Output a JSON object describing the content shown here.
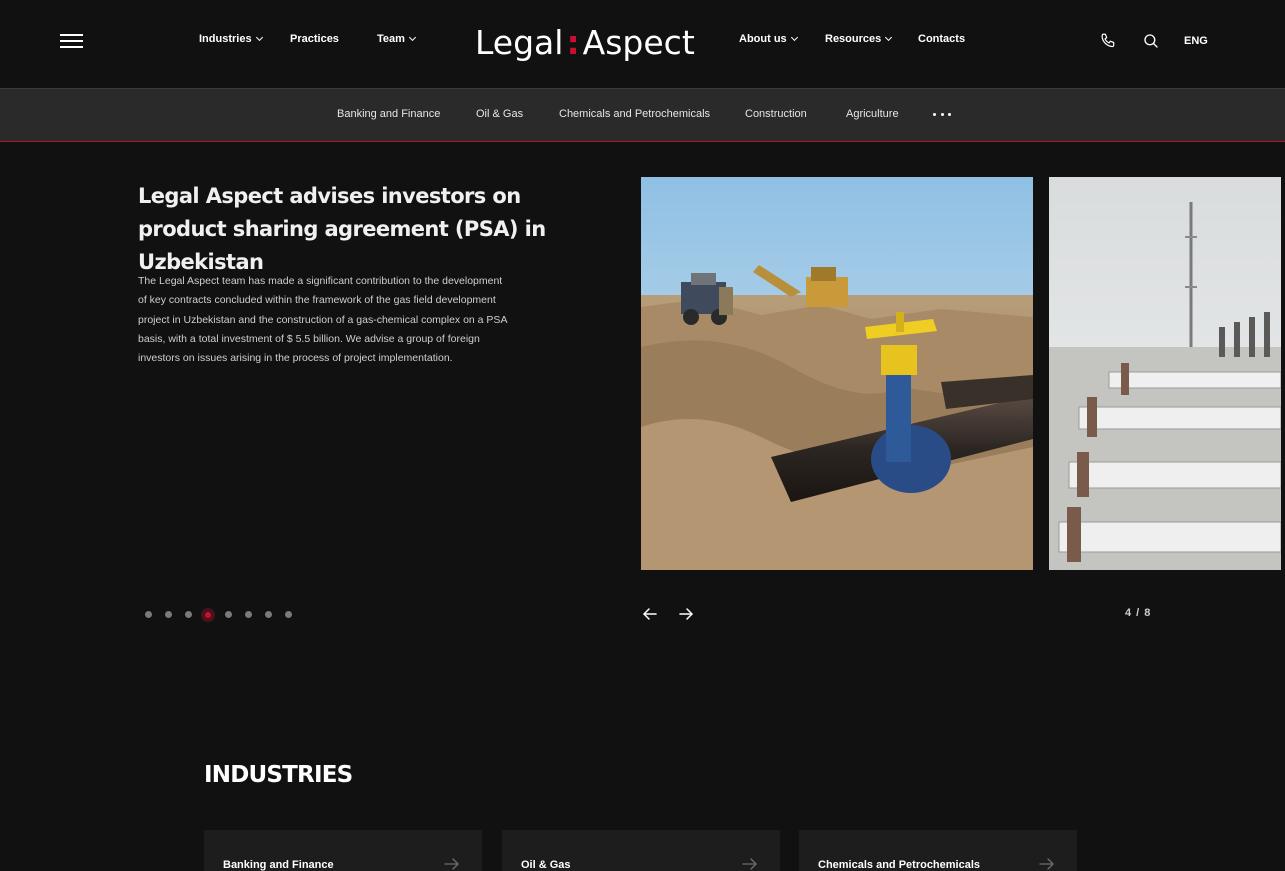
{
  "header": {
    "logo_left": "Legal",
    "logo_colon": ":",
    "logo_right": "Aspect",
    "nav": {
      "industries": "Industries",
      "practices": "Practices",
      "team": "Team",
      "about": "About us",
      "resources": "Resources",
      "contacts": "Contacts"
    },
    "language": "ENG"
  },
  "subnav": {
    "items": [
      "Banking and Finance",
      "Oil & Gas",
      "Chemicals and Petrochemicals",
      "Construction",
      "Agriculture"
    ]
  },
  "hero": {
    "title": "Legal Aspect advises investors on product sharing agreement (PSA) in Uzbekistan",
    "body": "The Legal Aspect team has made a significant contribution to the development of key contracts concluded within the framework of the gas field development project in Uzbekistan and the construction of a gas-chemical complex on a PSA basis, with a total investment of $ 5.5 billion. We advise a group of foreign investors on issues arising in the process of project implementation.",
    "counter": "4 / 8",
    "slides_total": 8,
    "active_slide": 4
  },
  "industries": {
    "title": "INDUSTRIES",
    "cards": [
      "Banking and Finance",
      "Oil & Gas",
      "Chemicals and Petrochemicals"
    ]
  },
  "colors": {
    "background": "#111112",
    "subnav_background": "#2a2a2b",
    "accent": "#c8102e",
    "card_background": "#1d1d1e"
  },
  "icons": {
    "menu": "hamburger-icon",
    "phone": "phone-icon",
    "search": "search-icon",
    "more": "more-dots-icon",
    "prev": "arrow-left-icon",
    "next": "arrow-right-icon",
    "card": "arrow-right-icon"
  }
}
